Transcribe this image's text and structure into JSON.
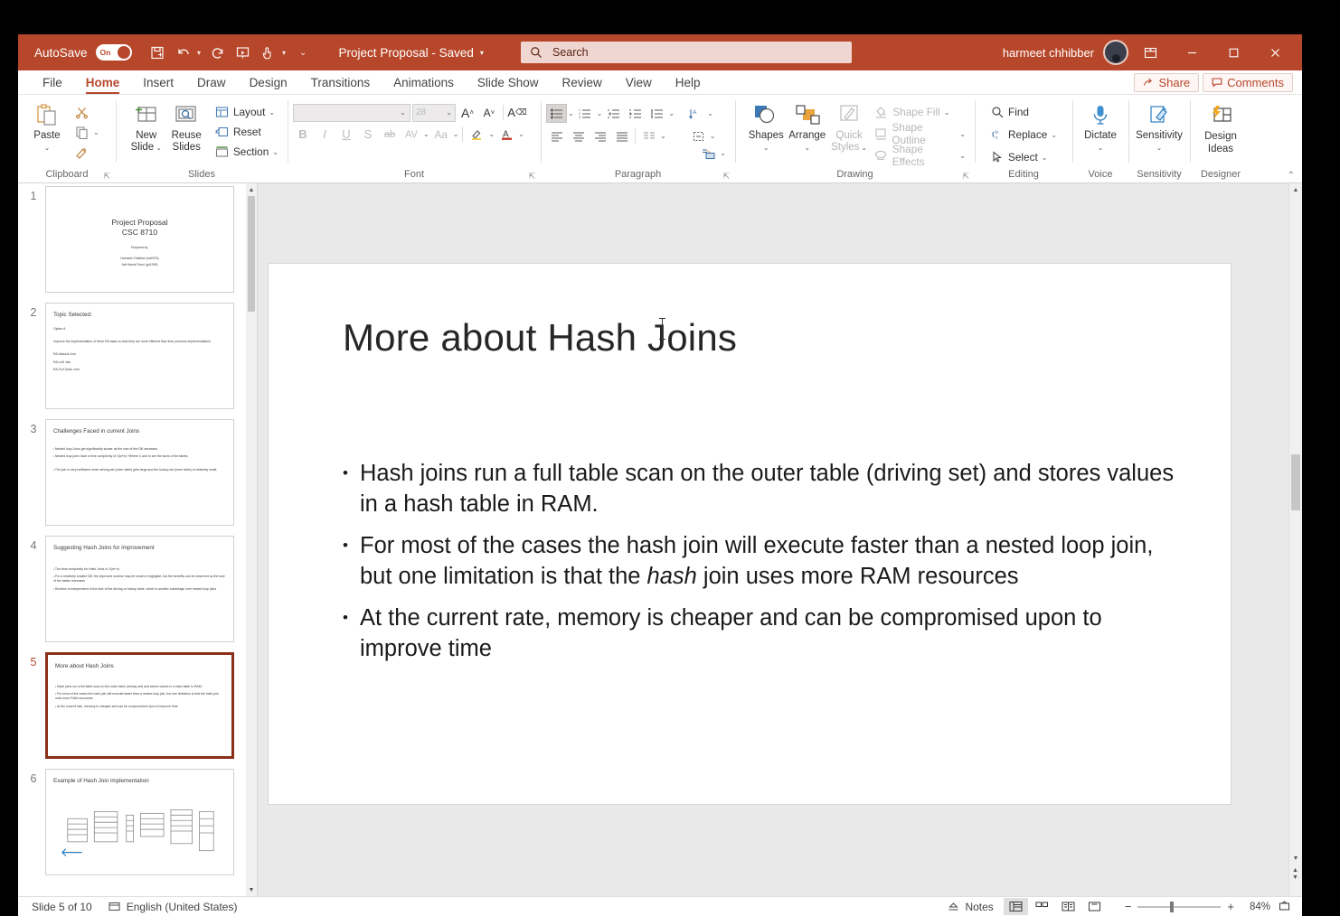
{
  "titlebar": {
    "autosave_label": "AutoSave",
    "autosave_state": "On",
    "document_title": "Project Proposal  -  Saved",
    "search_placeholder": "Search",
    "user_name": "harmeet chhibber",
    "accent_color": "#b7472a",
    "qat": [
      {
        "name": "save-icon",
        "label": "Save"
      },
      {
        "name": "undo-icon",
        "label": "Undo"
      },
      {
        "name": "redo-icon",
        "label": "Redo"
      },
      {
        "name": "start-presentation-icon",
        "label": "Start From Beginning"
      },
      {
        "name": "touch-mode-icon",
        "label": "Touch/Mouse Mode"
      },
      {
        "name": "customize-qat-icon",
        "label": "Customize Quick Access Toolbar"
      }
    ],
    "window_buttons": [
      {
        "name": "ribbon-display-options-icon",
        "glyph": "⊞"
      },
      {
        "name": "minimize-button",
        "glyph": "—"
      },
      {
        "name": "maximize-button",
        "glyph": "□"
      },
      {
        "name": "close-button",
        "glyph": "✕"
      }
    ]
  },
  "tabs": [
    {
      "label": "File",
      "active": false
    },
    {
      "label": "Home",
      "active": true
    },
    {
      "label": "Insert",
      "active": false
    },
    {
      "label": "Draw",
      "active": false
    },
    {
      "label": "Design",
      "active": false
    },
    {
      "label": "Transitions",
      "active": false
    },
    {
      "label": "Animations",
      "active": false
    },
    {
      "label": "Slide Show",
      "active": false
    },
    {
      "label": "Review",
      "active": false
    },
    {
      "label": "View",
      "active": false
    },
    {
      "label": "Help",
      "active": false
    }
  ],
  "tabs_right": {
    "share_label": "Share",
    "comments_label": "Comments"
  },
  "ribbon": {
    "clipboard": {
      "group_label": "Clipboard",
      "paste_label": "Paste",
      "cut_label": "Cut",
      "copy_label": "Copy",
      "format_painter_label": "Format Painter"
    },
    "slides": {
      "group_label": "Slides",
      "new_slide_line1": "New",
      "new_slide_line2": "Slide",
      "reuse_line1": "Reuse",
      "reuse_line2": "Slides",
      "layout_label": "Layout",
      "reset_label": "Reset",
      "section_label": "Section"
    },
    "font": {
      "group_label": "Font",
      "font_name_value": "",
      "font_size_value": "28",
      "grow_font": "A",
      "shrink_font": "A",
      "clear_formatting": "A",
      "bold": "B",
      "italic": "I",
      "underline": "U",
      "shadow": "S",
      "strikethrough": "ab",
      "character_spacing": "AV",
      "change_case": "Aa",
      "text_highlight": "A",
      "font_color": "A"
    },
    "paragraph": {
      "group_label": "Paragraph",
      "buttons": [
        "bullets",
        "numbering",
        "decrease-indent",
        "increase-indent",
        "line-spacing",
        "align-left",
        "align-center",
        "align-right",
        "justify",
        "columns",
        "text-direction",
        "align-text",
        "convert-to-smartart"
      ]
    },
    "drawing": {
      "group_label": "Drawing",
      "shapes_label": "Shapes",
      "arrange_label": "Arrange",
      "quick_styles_line1": "Quick",
      "quick_styles_line2": "Styles",
      "shape_fill_label": "Shape Fill",
      "shape_outline_label": "Shape Outline",
      "shape_effects_label": "Shape Effects"
    },
    "editing": {
      "group_label": "Editing",
      "find_label": "Find",
      "replace_label": "Replace",
      "select_label": "Select"
    },
    "voice": {
      "group_label": "Voice",
      "dictate_label": "Dictate"
    },
    "sensitivity": {
      "group_label": "Sensitivity",
      "button_label": "Sensitivity"
    },
    "designer": {
      "group_label": "Designer",
      "line1": "Design",
      "line2": "Ideas"
    }
  },
  "thumbnails": [
    {
      "number": "1",
      "kind": "title",
      "title": "Project Proposal",
      "subtitle": "CSC 8710",
      "prepared_by": "Prepared by:",
      "authors": [
        "Harmeet Chhibber (ha0076)",
        "Asif Kamal Torun (gn1090)"
      ],
      "current": false
    },
    {
      "number": "2",
      "kind": "content",
      "title": "Topic Selected:",
      "lines": [
        "Option A",
        "",
        "Improve the implementation of three RA tasks so that they are more efficient than their previous implementations",
        "",
        "RA-Natural Join",
        "RA-Left Join",
        "RA-Full Outer Join"
      ],
      "current": false
    },
    {
      "number": "3",
      "kind": "bullets",
      "title": "Challenges Faced in current Joins",
      "bullets": [
        "Nested loop Joins get significantly slower as the size of the DB increases.",
        "Nested loop joins have a time complexity of O(n*m) *Where n and m are the sizes of the tables.",
        "The join is very inefficient when driving set (outer table) gets large and the lookup set (inner table) is relatively small."
      ],
      "current": false
    },
    {
      "number": "4",
      "kind": "bullets",
      "title": "Suggesting Hash Joins for improvement",
      "bullets": [
        "The time complexity for Hash Joins is O(m+n)",
        "For a relatively smaller DB, the improved runtime may be small or negligible, but the benefits can be observed as the size of the tables increases",
        "Runtime is independent of the size of the driving or lookup table, which is another advantage over nested loop joins"
      ],
      "current": false
    },
    {
      "number": "5",
      "kind": "bullets",
      "title": "More about Hash Joins",
      "bullets": [
        "Hash joins run a full table scan on the outer table (driving set) and stores values in a hash table in RAM.",
        "For most of the cases the hash join will execute faster than a nested loop join, but one limitation is that the hash join uses more RAM resources.",
        "At the current rate, memory is cheaper and can be compromised upon to improve time"
      ],
      "current": true
    },
    {
      "number": "6",
      "kind": "diagram",
      "title": "Example of Hash Join implementation",
      "current": false
    }
  ],
  "slide": {
    "title": "More about Hash Joins",
    "bullets": [
      {
        "pre": "Hash joins run a full table scan on the outer table (driving set) and stores values in a hash table in RAM.",
        "italic": "",
        "post": ""
      },
      {
        "pre": "For most of the cases the hash join will execute faster than a nested loop join, but one limitation is that the ",
        "italic": "hash",
        "post": " join uses more RAM resources"
      },
      {
        "pre": "At the current rate, memory is cheaper and can be compromised upon to improve time",
        "italic": "",
        "post": ""
      }
    ]
  },
  "statusbar": {
    "slide_counter": "Slide 5 of 10",
    "language": "English (United States)",
    "notes_label": "Notes",
    "views": [
      {
        "name": "normal-view-button",
        "selected": true
      },
      {
        "name": "slide-sorter-view-button",
        "selected": false
      },
      {
        "name": "reading-view-button",
        "selected": false
      },
      {
        "name": "slide-show-button",
        "selected": false
      }
    ],
    "zoom_percent": "84%",
    "zoom_out_glyph": "−",
    "zoom_in_glyph": "+",
    "fit_label": "Fit slide to current window"
  }
}
